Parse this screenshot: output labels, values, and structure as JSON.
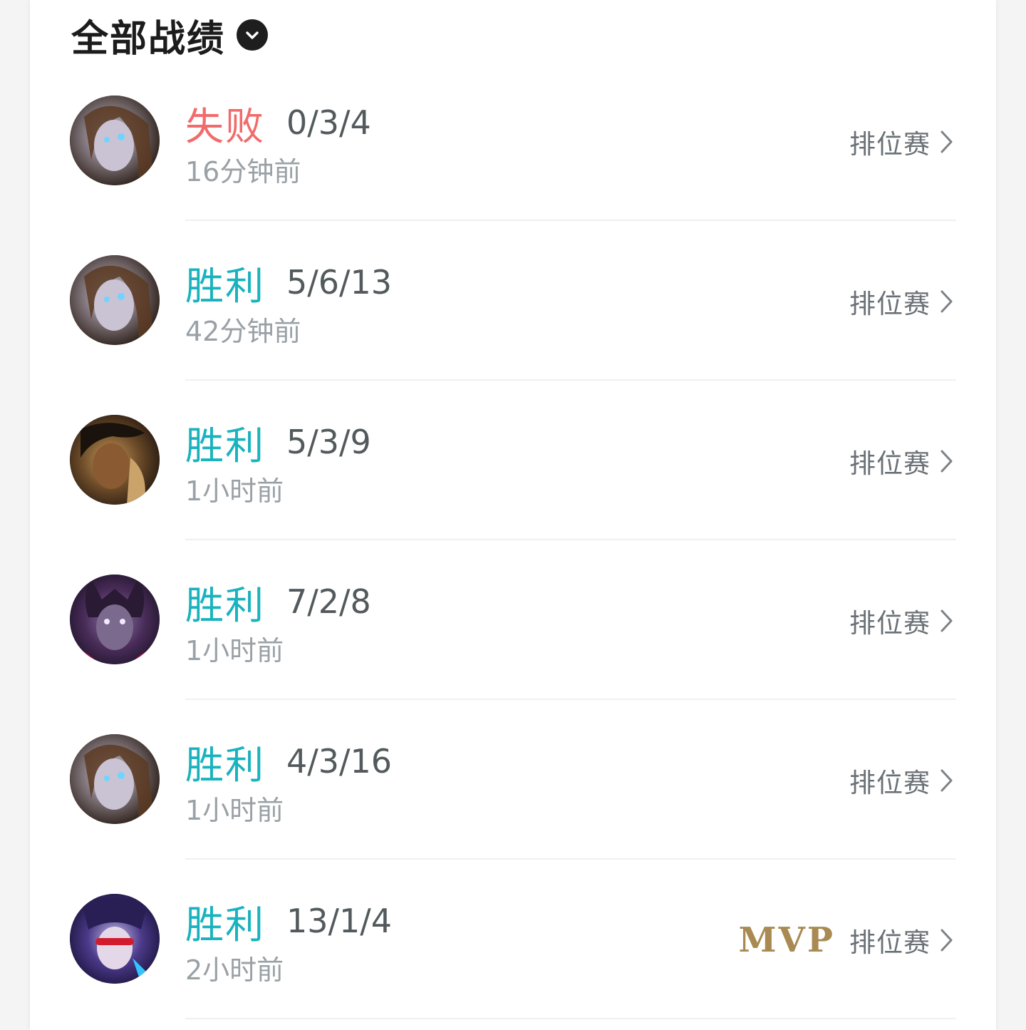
{
  "header": {
    "title": "全部战绩",
    "dropdown_icon": "chevron-down-circle-icon"
  },
  "colors": {
    "loss": "#f26b6b",
    "win": "#19b3bf",
    "mvp": "#a88a52"
  },
  "matches": [
    {
      "result": "失败",
      "outcome": "loss",
      "kda": "0/3/4",
      "time": "16分钟前",
      "mode": "排位赛",
      "mvp": "",
      "hero_icon": "hero-avatar-icon"
    },
    {
      "result": "胜利",
      "outcome": "win",
      "kda": "5/6/13",
      "time": "42分钟前",
      "mode": "排位赛",
      "mvp": "",
      "hero_icon": "hero-avatar-icon"
    },
    {
      "result": "胜利",
      "outcome": "win",
      "kda": "5/3/9",
      "time": "1小时前",
      "mode": "排位赛",
      "mvp": "",
      "hero_icon": "hero-avatar-icon"
    },
    {
      "result": "胜利",
      "outcome": "win",
      "kda": "7/2/8",
      "time": "1小时前",
      "mode": "排位赛",
      "mvp": "",
      "hero_icon": "hero-avatar-icon"
    },
    {
      "result": "胜利",
      "outcome": "win",
      "kda": "4/3/16",
      "time": "1小时前",
      "mode": "排位赛",
      "mvp": "",
      "hero_icon": "hero-avatar-icon"
    },
    {
      "result": "胜利",
      "outcome": "win",
      "kda": "13/1/4",
      "time": "2小时前",
      "mode": "排位赛",
      "mvp": "MVP",
      "hero_icon": "hero-avatar-icon"
    }
  ]
}
